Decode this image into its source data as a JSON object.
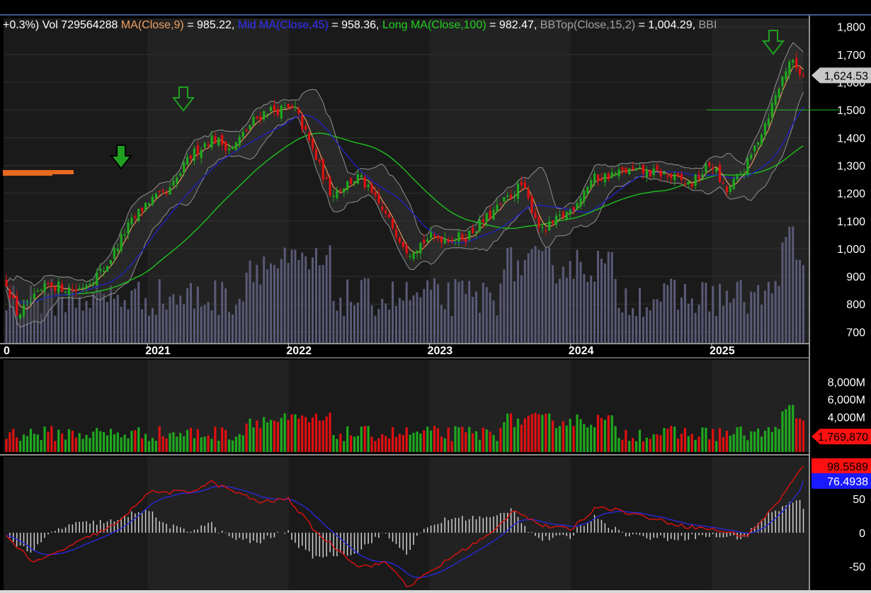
{
  "header": {
    "change": "+0.3%)",
    "vol_label": "Vol",
    "vol_value": "729564288",
    "ma_label": "MA(Close,9)",
    "ma_value": "= 985.22,",
    "mid_label": "Mid MA(Close,45)",
    "mid_value": "= 958.36,",
    "long_label": "Long MA(Close,100)",
    "long_value": "= 982.47,",
    "bb_label": "BBTop(Close,15,2)",
    "bb_value": "= 1,004.29,",
    "bb_tail": "BBI"
  },
  "colors": {
    "background": "#000000",
    "panel": "#1a1a1a",
    "band_alt": "#222222",
    "up": "#1fa81f",
    "down": "#e01010",
    "ma9": "#f0a060",
    "mid_ma": "#2020c0",
    "long_ma": "#20c020",
    "bollinger": "#909090",
    "volume_overlay": "#5a5a78",
    "macd_line": "#e01010",
    "signal_line": "#2828d8",
    "arrow": "#20a020"
  },
  "chart_data": [
    {
      "type": "candlestick",
      "panel": "price",
      "x_ticks": [
        "0",
        "2021",
        "2022",
        "2023",
        "2024",
        "2025"
      ],
      "y_ticks": [
        "700",
        "800",
        "900",
        "1,000",
        "1,100",
        "1,200",
        "1,300",
        "1,400",
        "1,500",
        "1,600",
        "1,700",
        "1,800"
      ],
      "ylim": [
        660,
        1830
      ],
      "last_price": "1,624.53",
      "horizontal_line": 1500,
      "approx_close": [
        {
          "x": 0,
          "y": 880
        },
        {
          "x": 0.08,
          "y": 760
        },
        {
          "x": 0.3,
          "y": 870
        },
        {
          "x": 0.5,
          "y": 850
        },
        {
          "x": 0.7,
          "y": 930
        },
        {
          "x": 0.85,
          "y": 1070
        },
        {
          "x": 1.0,
          "y": 1170
        },
        {
          "x": 1.15,
          "y": 1200
        },
        {
          "x": 1.3,
          "y": 1330
        },
        {
          "x": 1.45,
          "y": 1400
        },
        {
          "x": 1.6,
          "y": 1360
        },
        {
          "x": 1.75,
          "y": 1460
        },
        {
          "x": 1.85,
          "y": 1500
        },
        {
          "x": 2.05,
          "y": 1500
        },
        {
          "x": 2.15,
          "y": 1380
        },
        {
          "x": 2.3,
          "y": 1200
        },
        {
          "x": 2.5,
          "y": 1260
        },
        {
          "x": 2.65,
          "y": 1150
        },
        {
          "x": 2.85,
          "y": 990
        },
        {
          "x": 3.0,
          "y": 1040
        },
        {
          "x": 3.25,
          "y": 1040
        },
        {
          "x": 3.45,
          "y": 1130
        },
        {
          "x": 3.65,
          "y": 1230
        },
        {
          "x": 3.8,
          "y": 1060
        },
        {
          "x": 4.0,
          "y": 1140
        },
        {
          "x": 4.15,
          "y": 1250
        },
        {
          "x": 4.4,
          "y": 1280
        },
        {
          "x": 4.65,
          "y": 1270
        },
        {
          "x": 4.85,
          "y": 1230
        },
        {
          "x": 5.0,
          "y": 1310
        },
        {
          "x": 5.1,
          "y": 1200
        },
        {
          "x": 5.25,
          "y": 1300
        },
        {
          "x": 5.4,
          "y": 1480
        },
        {
          "x": 5.55,
          "y": 1680
        },
        {
          "x": 5.65,
          "y": 1624.53
        }
      ],
      "ma9_end": 985.22,
      "mid_ma_end": 958.36,
      "long_ma_end": 982.47,
      "bbtop_end": 1004.29
    },
    {
      "type": "bar",
      "panel": "volume",
      "y_ticks": [
        "4,000M",
        "6,000M",
        "8,000M"
      ],
      "ylim": [
        0,
        10500
      ],
      "last_value": "1,769,870",
      "unit": "M"
    },
    {
      "type": "line",
      "panel": "oscillator",
      "y_ticks": [
        "-50",
        "0",
        "50"
      ],
      "ylim": [
        -85,
        112
      ],
      "series": [
        {
          "key": "fast",
          "last": "98.5589"
        },
        {
          "key": "signal",
          "last": "76.4938"
        }
      ],
      "approx_fast": [
        {
          "x": 0,
          "y": -5
        },
        {
          "x": 0.2,
          "y": -45
        },
        {
          "x": 0.5,
          "y": -15
        },
        {
          "x": 0.8,
          "y": 15
        },
        {
          "x": 1.0,
          "y": 60
        },
        {
          "x": 1.3,
          "y": 60
        },
        {
          "x": 1.45,
          "y": 75
        },
        {
          "x": 1.8,
          "y": 45
        },
        {
          "x": 2.0,
          "y": 50
        },
        {
          "x": 2.2,
          "y": 0
        },
        {
          "x": 2.5,
          "y": -50
        },
        {
          "x": 2.7,
          "y": -45
        },
        {
          "x": 2.85,
          "y": -80
        },
        {
          "x": 3.2,
          "y": -30
        },
        {
          "x": 3.45,
          "y": 0
        },
        {
          "x": 3.6,
          "y": 35
        },
        {
          "x": 3.8,
          "y": 10
        },
        {
          "x": 4.0,
          "y": 5
        },
        {
          "x": 4.2,
          "y": 40
        },
        {
          "x": 4.5,
          "y": 25
        },
        {
          "x": 4.8,
          "y": 10
        },
        {
          "x": 5.0,
          "y": 5
        },
        {
          "x": 5.25,
          "y": -5
        },
        {
          "x": 5.45,
          "y": 40
        },
        {
          "x": 5.65,
          "y": 98.5589
        }
      ]
    }
  ]
}
